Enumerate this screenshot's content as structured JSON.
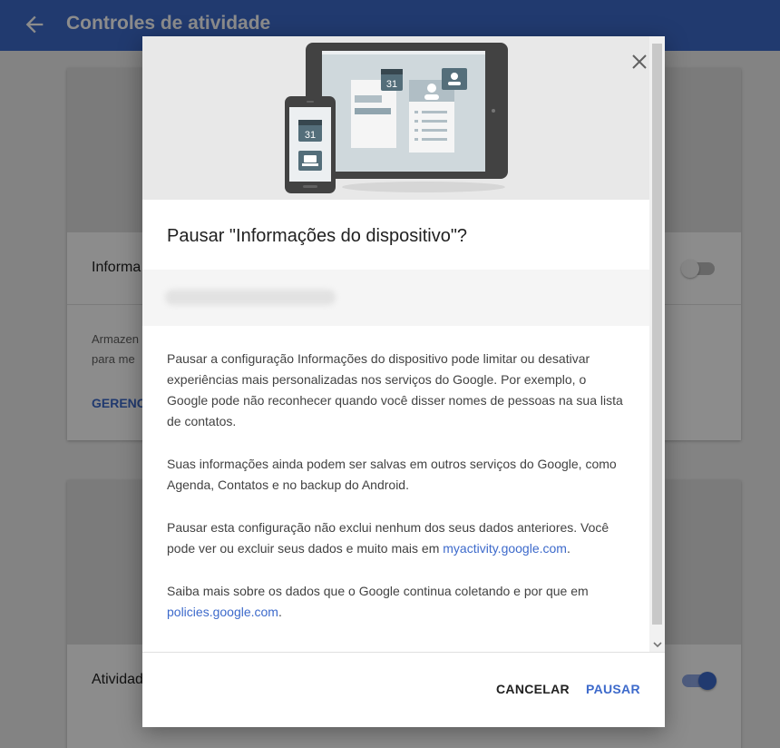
{
  "app_bar": {
    "title": "Controles de atividade"
  },
  "cards": [
    {
      "row_title": "Informa",
      "description_lines": [
        "Armazen",
        "para me"
      ],
      "link": "GERENC"
    },
    {
      "row_title": "Atividad"
    }
  ],
  "dialog": {
    "title": "Pausar \"Informações do dispositivo\"?",
    "paragraphs": [
      "Pausar a configuração Informações do dispositivo pode limitar ou desativar experiências mais personalizadas nos serviços do Google. Por exemplo, o Google pode não reconhecer quando você disser nomes de pessoas na sua lista de contatos.",
      "Suas informações ainda podem ser salvas em outros serviços do Google, como Agenda, Contatos e no backup do Android."
    ],
    "paragraph3_text": "Pausar esta configuração não exclui nenhum dos seus dados anteriores. Você pode ver ou excluir seus dados e muito mais em ",
    "paragraph3_link": "myactivity.google.com",
    "paragraph3_end": ".",
    "paragraph4_text": "Saiba mais sobre os dados que o Google continua coletando e por que em ",
    "paragraph4_link": "policies.google.com",
    "paragraph4_end": ".",
    "calendar_day": "31",
    "cancel_label": "CANCELAR",
    "pause_label": "PAUSAR"
  },
  "colors": {
    "primary": "#3d6acb",
    "toggle_on_track": "#8fa8e6",
    "toggle_off_track": "#bdbdbd"
  }
}
